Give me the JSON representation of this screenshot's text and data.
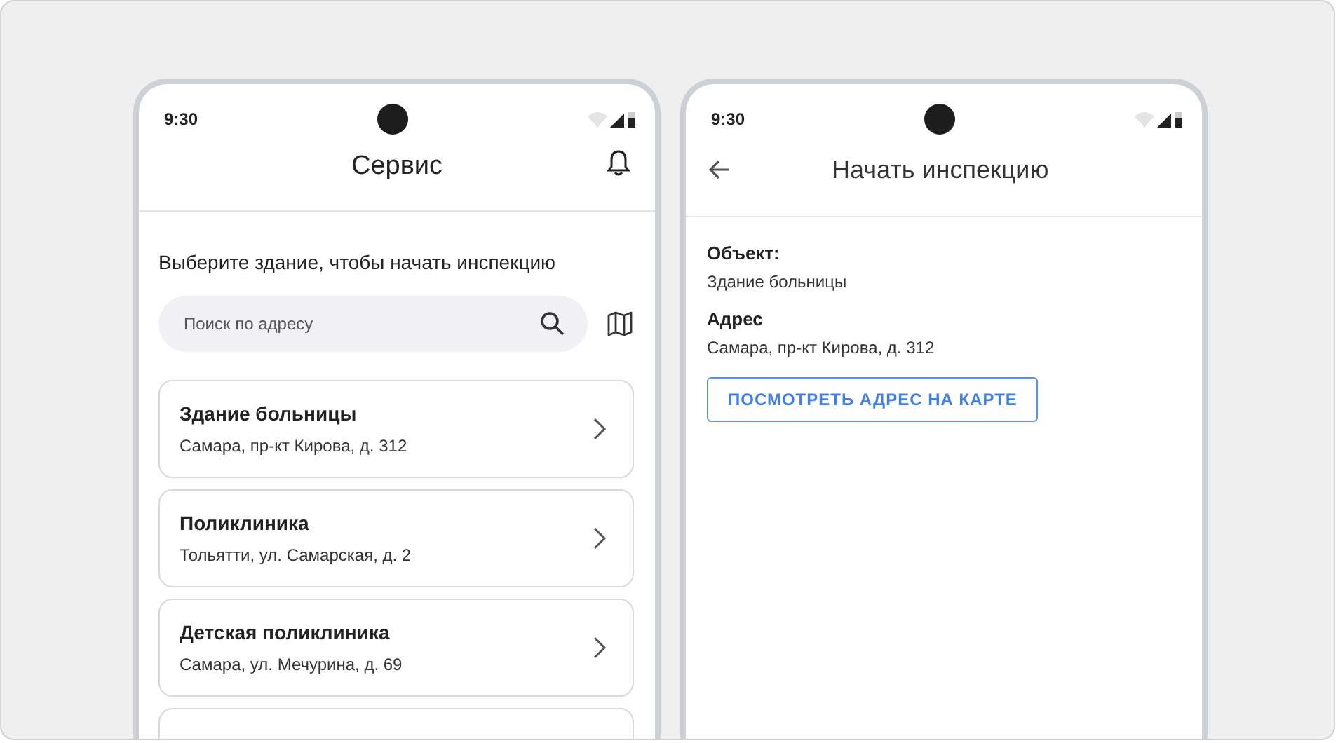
{
  "screens": [
    {
      "kind": "list",
      "status_time": "9:30",
      "title": "Сервис",
      "prompt": "Выберите здание, чтобы начать инспекцию",
      "search": {
        "placeholder": "Поиск по адресу"
      },
      "items": [
        {
          "title": "Здание больницы",
          "address": "Самара, пр-кт Кирова, д. 312"
        },
        {
          "title": "Поликлиника",
          "address": "Тольятти, ул. Самарская, д. 2"
        },
        {
          "title": "Детская поликлиника",
          "address": "Самара, ул. Мечурина, д. 69"
        }
      ]
    },
    {
      "kind": "detail",
      "status_time": "9:30",
      "title": "Начать инспекцию",
      "fields": [
        {
          "label": "Объект:",
          "value": "Здание больницы"
        },
        {
          "label": "Адрес",
          "value": "Самара, пр-кт Кирова, д. 312"
        }
      ],
      "button": "ПОСМОТРЕТЬ АДРЕС НА КАРТЕ"
    }
  ]
}
